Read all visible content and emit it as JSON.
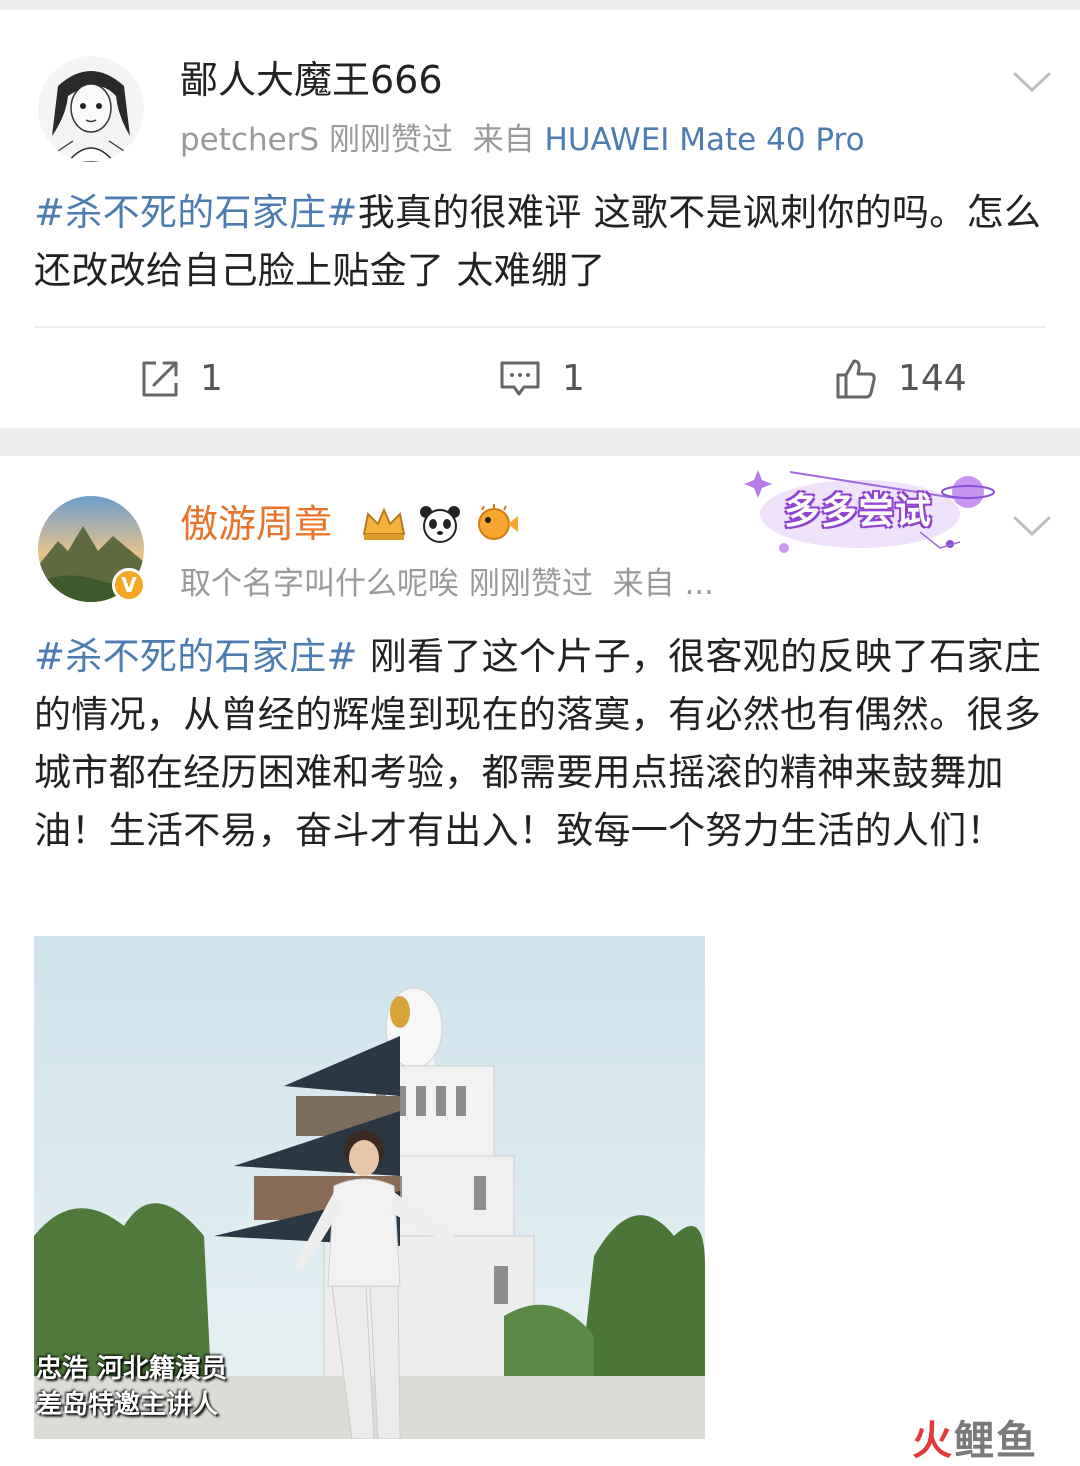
{
  "post1": {
    "username": "鄙人大魔王666",
    "liked_by": "petcherS",
    "time": "刚刚赞过",
    "source_prefix": "来自",
    "source": "HUAWEI Mate 40 Pro",
    "hashtag": "#杀不死的石家庄#",
    "text": "我真的很难评 这歌不是讽刺你的吗。怎么还改改给自己脸上贴金了 太难绷了",
    "actions": {
      "repost": {
        "icon": "share-icon",
        "count": "1"
      },
      "comment": {
        "icon": "comment-icon",
        "count": "1"
      },
      "like": {
        "icon": "thumbs-up-icon",
        "count": "144"
      }
    }
  },
  "post2": {
    "username": "傲游周章",
    "liked_by": "取个名字叫什么呢唉",
    "time": "刚刚赞过",
    "source_prefix": "来自",
    "source": "...",
    "verified_badge": "V",
    "promo": "多多尝试",
    "hashtag": "#杀不死的石家庄#",
    "text": " 刚看了这个片子，很客观的反映了石家庄的情况，从曾经的辉煌到现在的落寞，有必然也有偶然。很多城市都在经历困难和考验，都需要用点摇滚的精神来鼓舞加油！生活不易，奋斗才有出入！致每一个努力生活的人们！",
    "image_caption_line1": "忠浩  河北籍演员",
    "image_caption_line2": "差岛特邀主讲人"
  },
  "watermark": {
    "part1": "火",
    "part2": "鲤鱼"
  },
  "colors": {
    "link": "#4c7cb2",
    "username2": "#e8742c",
    "gray": "#9a9a9a"
  }
}
